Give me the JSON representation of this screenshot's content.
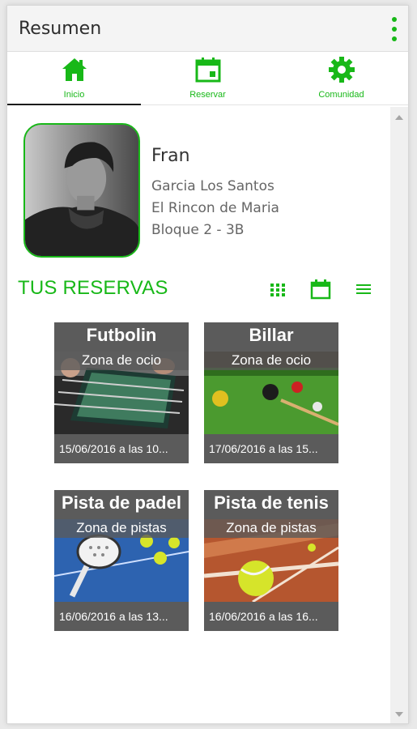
{
  "app": {
    "title": "Resumen"
  },
  "tabs": [
    {
      "label": "Inicio",
      "icon": "home-icon",
      "active": true
    },
    {
      "label": "Reservar",
      "icon": "calendar-icon",
      "active": false
    },
    {
      "label": "Comunidad",
      "icon": "gear-icon",
      "active": false
    }
  ],
  "profile": {
    "name": "Fran",
    "surname": "Garcia Los Santos",
    "community": "El Rincon de Maria",
    "address": "Bloque 2 - 3B"
  },
  "reservations": {
    "title": "TUS RESERVAS",
    "view_icons": [
      "grid-view-icon",
      "calendar-view-icon",
      "list-view-icon"
    ],
    "items": [
      {
        "title": "Futbolin",
        "zone": "Zona de ocio",
        "date": "15/06/2016 a las 10..."
      },
      {
        "title": "Billar",
        "zone": "Zona de ocio",
        "date": "17/06/2016 a las 15..."
      },
      {
        "title": "Pista de padel",
        "zone": "Zona de pistas",
        "date": "16/06/2016 a las 13..."
      },
      {
        "title": "Pista de tenis",
        "zone": "Zona de pistas",
        "date": "16/06/2016 a las 16..."
      }
    ]
  },
  "colors": {
    "accent": "#18b818",
    "card": "#5b5b5b"
  }
}
